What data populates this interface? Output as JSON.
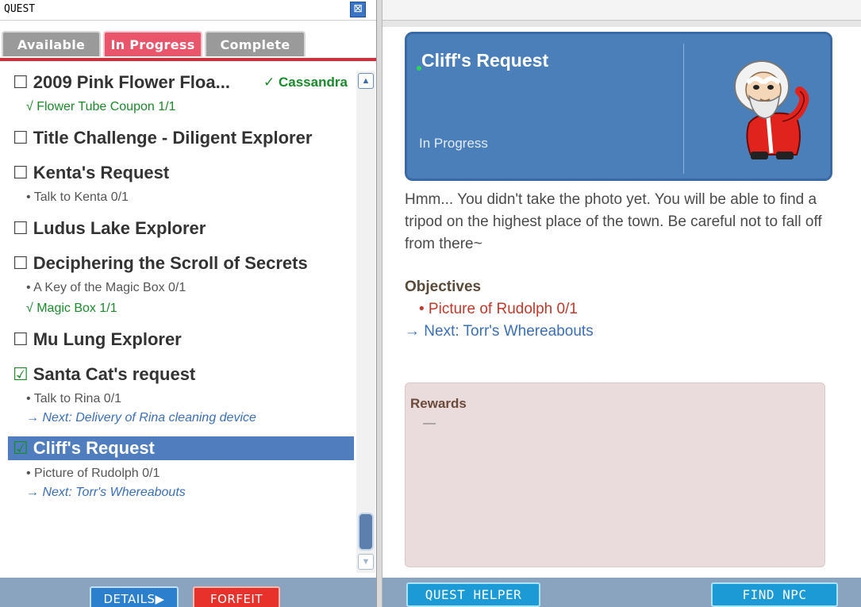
{
  "window": {
    "title": "QUEST",
    "close_glyph": "⊠"
  },
  "tabs": [
    {
      "label": "Available",
      "active": false
    },
    {
      "label": "In Progress",
      "active": true
    },
    {
      "label": "Complete",
      "active": false
    }
  ],
  "quests": [
    {
      "title": "2009 Pink Flower Floa...",
      "checked": false,
      "npc": "✓ Cassandra",
      "details": [
        {
          "text": "√ Flower Tube Coupon  1/1",
          "state": "done"
        }
      ]
    },
    {
      "title": "Title Challenge - Diligent Explorer",
      "checked": false,
      "details": []
    },
    {
      "title": "Kenta's Request",
      "checked": false,
      "details": [
        {
          "text": "• Talk to Kenta  0/1",
          "state": "todo"
        }
      ]
    },
    {
      "title": "Ludus Lake Explorer",
      "checked": false,
      "details": []
    },
    {
      "title": "Deciphering the Scroll of Secrets",
      "checked": false,
      "details": [
        {
          "text": "• A Key of the Magic Box  0/1",
          "state": "todo"
        },
        {
          "text": "√ Magic Box  1/1",
          "state": "done"
        }
      ]
    },
    {
      "title": "Mu Lung Explorer",
      "checked": false,
      "details": []
    },
    {
      "title": "Santa Cat's request",
      "checked": true,
      "details": [
        {
          "text": "• Talk to Rina  0/1",
          "state": "todo"
        },
        {
          "text": "→ Next: Delivery of Rina cleaning device",
          "state": "next"
        }
      ]
    },
    {
      "title": "Cliff's Request",
      "checked": true,
      "selected": true,
      "details": [
        {
          "text": "• Picture of Rudolph  0/1",
          "state": "todo"
        },
        {
          "text": "→ Next: Torr's Whereabouts",
          "state": "next"
        }
      ]
    }
  ],
  "checkbox": {
    "unchecked": "☐",
    "checked": "☑"
  },
  "buttons": {
    "details": "DETAILS▶",
    "forfeit": "FORFEIT",
    "quest_helper": "QUEST HELPER",
    "find_npc": "FIND NPC"
  },
  "scroll": {
    "up_glyph": "▲",
    "down_glyph": "▼"
  },
  "detail": {
    "title": "Cliff's Request",
    "status": "In Progress",
    "description": "Hmm...  You didn't take the photo yet.  You will be able to find a tripod on the highest place of the town.  Be careful not to fall off from there~",
    "objectives_heading": "Objectives",
    "objective": "• Picture of Rudolph  0/1",
    "next": "→ Next: Torr's Whereabouts",
    "rewards_heading": "Rewards",
    "rewards_value": "—",
    "npc_icon": "santa-old-man-icon"
  },
  "colors": {
    "tab_active": "#e9556a",
    "tab_inactive": "#9a9a9a",
    "selected_row": "#4f7dbd",
    "done_green": "#1a8a2a",
    "next_blue": "#3b6fb6",
    "objective_red": "#c0392b",
    "header_blue": "#4b7fba"
  }
}
